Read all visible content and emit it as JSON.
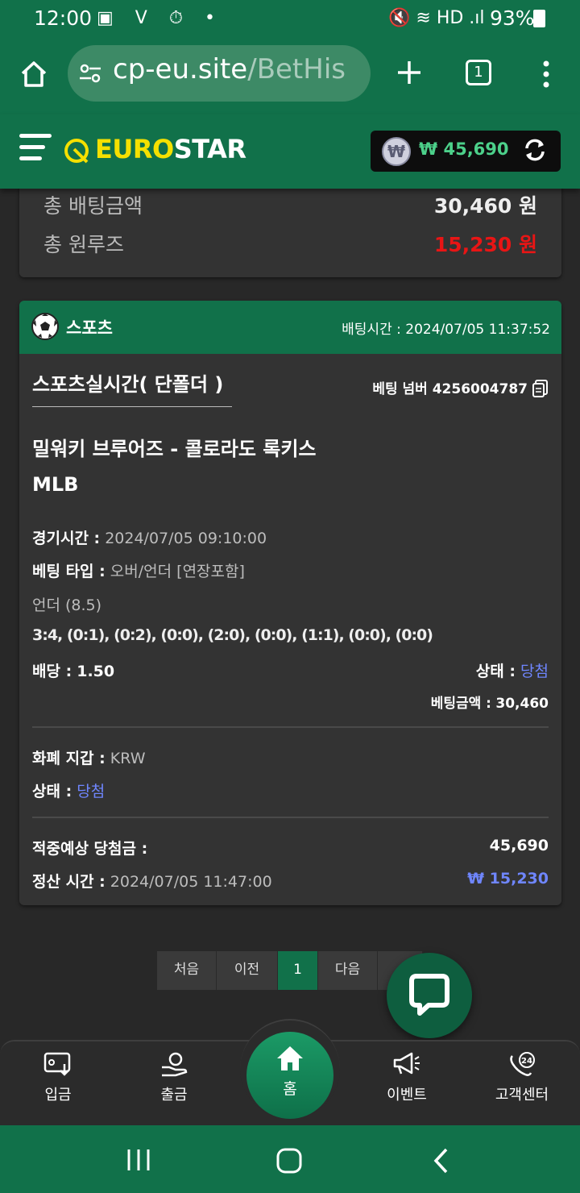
{
  "status_bar": {
    "time": "12:00",
    "battery": "93%"
  },
  "browser": {
    "url_host": "cp-eu.site",
    "url_path": "/BetHis",
    "tab_count": "1"
  },
  "site": {
    "logo_yellow": "EURO",
    "logo_white": "STAR",
    "balance": "₩ 45,690",
    "currency_symbol": "₩"
  },
  "summary": {
    "total_bet_label": "총 배팅금액",
    "total_bet_value": "30,460 원",
    "total_winloss_label": "총 원루즈",
    "total_winloss_value": "15,230 원"
  },
  "bet": {
    "category": "스포츠",
    "bet_time": "배팅시간 : 2024/07/05 11:37:52",
    "title": "스포츠실시간( 단폴더 )",
    "bet_number": "베팅 넘버 4256004787",
    "match": "밀워키 브루어즈 - 콜로라도 록키스",
    "league": "MLB",
    "game_time_label": "경기시간 :",
    "game_time_value": "2024/07/05 09:10:00",
    "bet_type_label": "베팅 타입 :",
    "bet_type_value": "오버/언더 [연장포함]",
    "pick": "언더 (8.5)",
    "score": "3:4, (0:1), (0:2), (0:0), (2:0), (0:0), (1:1), (0:0), (0:0)",
    "odds_label": "배당 :",
    "odds_value": "1.50",
    "status_label": "상태 :",
    "status_value": "당첨",
    "bet_amount_label": "베팅금액 :",
    "bet_amount_value": "30,460",
    "wallet_label": "화폐 지갑 :",
    "wallet_value": "KRW",
    "status2_label": "상태 :",
    "status2_value": "당첨",
    "expected_win_label": "적중예상 당첨금 :",
    "expected_win_value": "45,690",
    "settle_time_label": "정산 시간 :",
    "settle_time_value": "2024/07/05 11:47:00",
    "settle_amount": "₩ 15,230"
  },
  "pagination": {
    "first": "처음",
    "prev": "이전",
    "current": "1",
    "next": "다음"
  },
  "bottom_nav": {
    "deposit": "입금",
    "withdraw": "출금",
    "home": "홈",
    "event": "이벤트",
    "support": "고객센터",
    "support_badge": "24"
  },
  "colors": {
    "brand_green": "#11714a",
    "logo_yellow": "#f5e000",
    "loss_red": "#e81515",
    "win_blue": "#6f86ff",
    "balance_green": "#4cd08a"
  }
}
